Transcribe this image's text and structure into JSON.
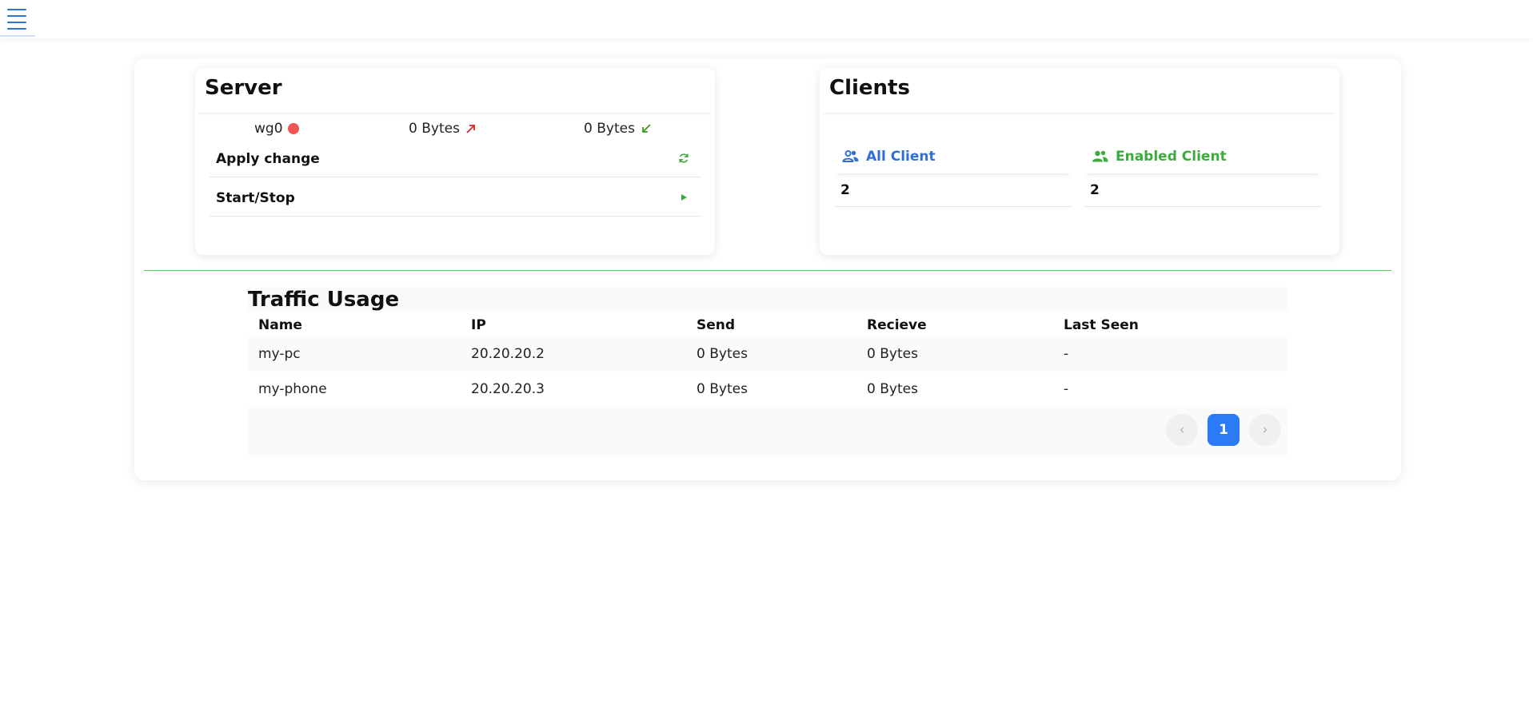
{
  "topbar": {
    "menu_icon": "hamburger-menu-icon"
  },
  "server": {
    "title": "Server",
    "interface": {
      "name": "wg0",
      "status_color": "#f25353"
    },
    "sent": {
      "value": "0 Bytes",
      "icon": "arrow-up-right-icon",
      "color": "#d32a2a"
    },
    "received": {
      "value": "0 Bytes",
      "icon": "arrow-down-left-icon",
      "color": "#3a9a1e"
    },
    "actions": [
      {
        "label": "Apply change",
        "icon": "refresh-icon"
      },
      {
        "label": "Start/Stop",
        "icon": "play-icon"
      }
    ]
  },
  "clients": {
    "title": "Clients",
    "all": {
      "label": "All Client",
      "value": "2",
      "color": "#2f6fd6",
      "icon": "users-icon"
    },
    "enabled": {
      "label": "Enabled Client",
      "value": "2",
      "color": "#3daa3d",
      "icon": "users-icon"
    }
  },
  "traffic": {
    "title": "Traffic Usage",
    "columns": [
      "Name",
      "IP",
      "Send",
      "Recieve",
      "Last Seen"
    ],
    "rows": [
      [
        "my-pc",
        "20.20.20.2",
        "0 Bytes",
        "0 Bytes",
        "-"
      ],
      [
        "my-phone",
        "20.20.20.3",
        "0 Bytes",
        "0 Bytes",
        "-"
      ]
    ],
    "pagination": {
      "prev": "‹",
      "current": "1",
      "next": "›"
    }
  },
  "colors": {
    "accent": "#2b7bf7",
    "divider": "#5cc85c"
  }
}
